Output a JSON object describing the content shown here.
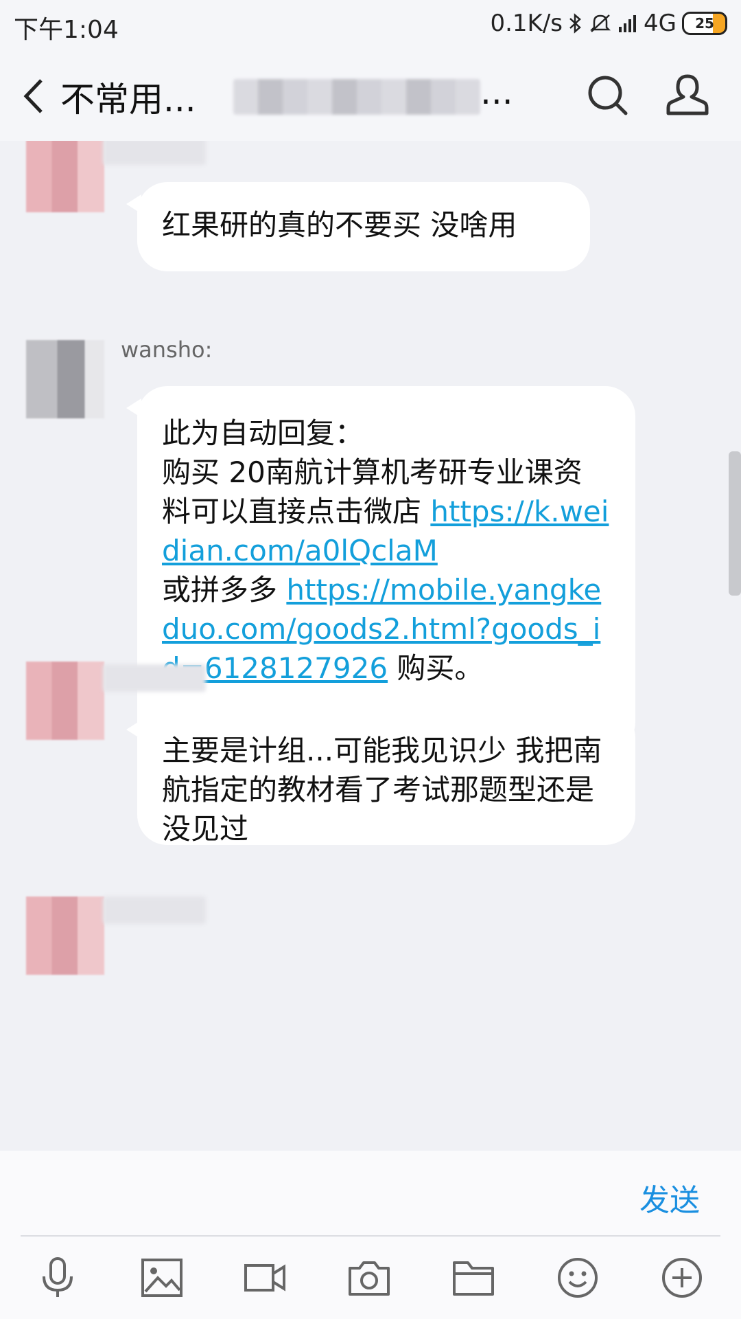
{
  "status_bar": {
    "time": "下午1:04",
    "net_speed": "0.1K/s",
    "network": "4G",
    "battery": "25"
  },
  "header": {
    "back_icon": "chevron-left-icon",
    "title": "不常用...",
    "title_suffix": "...",
    "search_icon": "search-icon",
    "profile_icon": "person-icon"
  },
  "messages": [
    {
      "sender": "",
      "text": "红果研的真的不要买 没啥用"
    },
    {
      "sender": "wansho:",
      "text_parts": [
        "此为自动回复：\n购买 20南航计算机考研专业课资料可以直接点击微店 ",
        "https://k.weidian.com/a0lQclaM",
        "\n或拼多多 ",
        "https://mobile.yangkeduo.com/goods2.html?goods_id=6128127926",
        " 购买。"
      ]
    },
    {
      "sender": "",
      "text": "主要是计组...可能我见识少 我把南航指定的教材看了考试那题型还是没见过"
    }
  ],
  "input": {
    "send_label": "发送"
  },
  "toolbar": {
    "icons": [
      "microphone-icon",
      "image-icon",
      "video-icon",
      "camera-icon",
      "folder-icon",
      "emoji-icon",
      "plus-icon"
    ]
  },
  "colors": {
    "link": "#139fdb",
    "send": "#1a8fe0",
    "background": "#f0f1f5"
  }
}
